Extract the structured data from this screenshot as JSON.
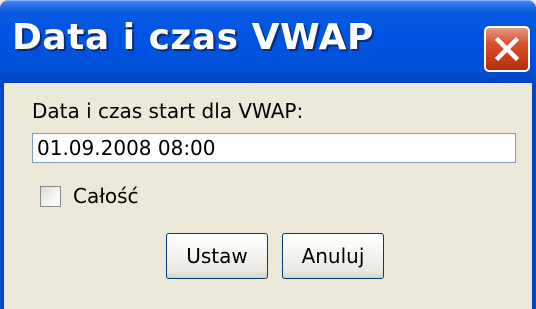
{
  "window": {
    "title": "Data i czas VWAP"
  },
  "form": {
    "label": "Data i czas start dla VWAP:",
    "datetime_value": "01.09.2008 08:00",
    "checkbox_label": "Całość",
    "checkbox_checked": false
  },
  "buttons": {
    "ok_label": "Ustaw",
    "cancel_label": "Anuluj"
  },
  "icons": {
    "close": "close-icon"
  },
  "colors": {
    "titlebar": "#0054e3",
    "close_button": "#d9522f",
    "dialog_bg": "#ece9d8",
    "field_border": "#7f9db9"
  }
}
